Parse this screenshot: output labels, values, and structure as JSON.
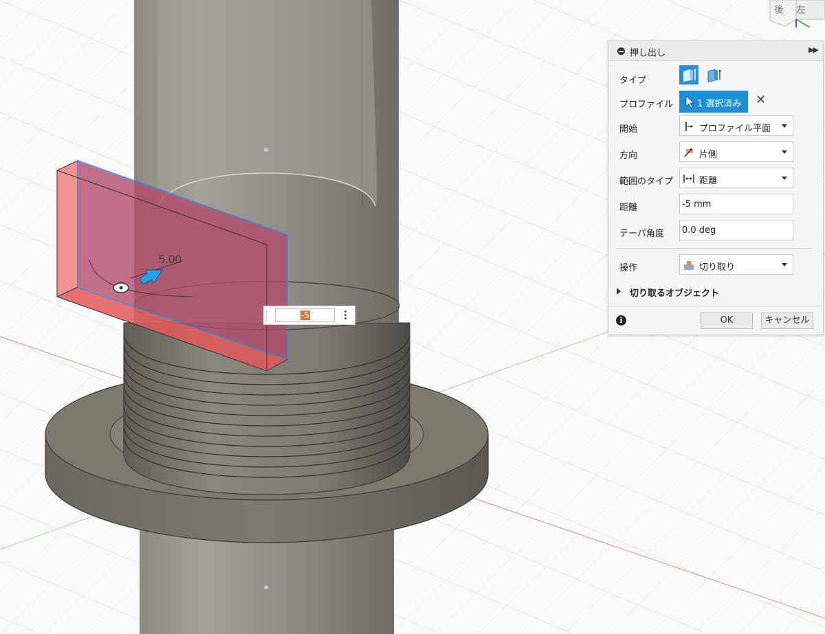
{
  "viewport": {
    "dimension_label": "5.00",
    "distance_input_value": "-5",
    "viewcube_back_label": "後",
    "viewcube_left_label": "左"
  },
  "panel": {
    "title": "押し出し",
    "expand_glyph": "▶▶",
    "type_label": "タイプ",
    "profile_label": "プロファイル",
    "profile_selected": "1 選択済み",
    "profile_clear_glyph": "✕",
    "start_label": "開始",
    "start_value": "プロファイル平面",
    "direction_label": "方向",
    "direction_value": "片側",
    "extent_type_label": "範囲のタイプ",
    "extent_type_value": "距離",
    "distance_label": "距離",
    "distance_value": "-5 mm",
    "taper_label": "テーパ角度",
    "taper_value": "0.0 deg",
    "operation_label": "操作",
    "operation_value": "切り取り",
    "targets_label": "切り取るオブジェクト",
    "info_glyph": "i",
    "ok_label": "OK",
    "cancel_label": "キャンセル"
  },
  "colors": {
    "accent": "#1d8fd6",
    "cut_profile_fill": "#c0506e",
    "model_body": "#7a786f",
    "highlight_edge": "#3a7bd5"
  }
}
